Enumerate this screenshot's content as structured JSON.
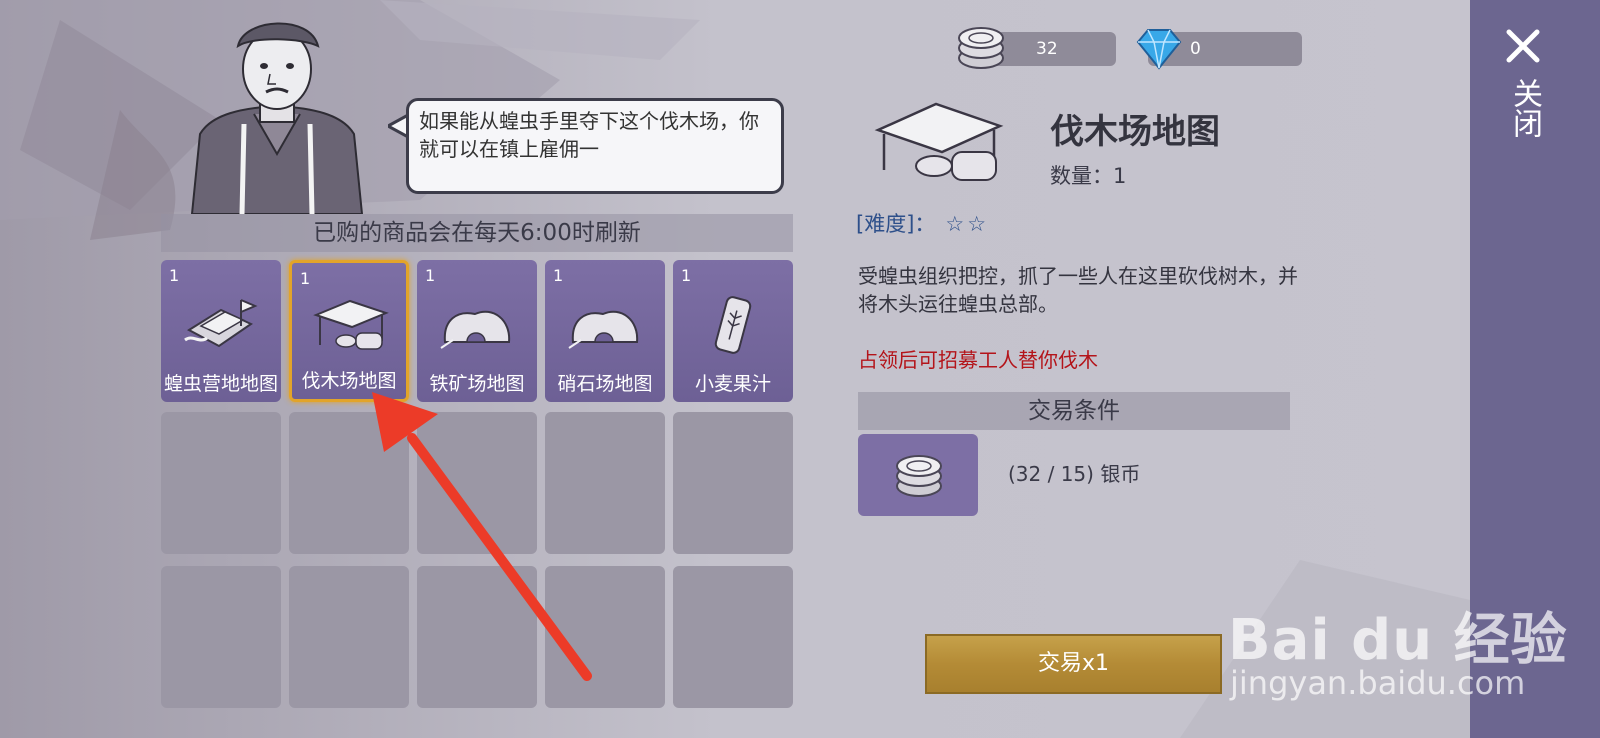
{
  "currency": {
    "silver_value": "32",
    "gem_value": "0"
  },
  "close": {
    "label": "关闭"
  },
  "npc": {
    "dialog": "如果能从蝗虫手里夺下这个伐木场，你就可以在镇上雇佣一"
  },
  "shop": {
    "refresh_notice": "已购的商品会在每天6:00时刷新",
    "items": [
      {
        "count": "1",
        "name": "蝗虫营地地图",
        "icon": "camp-map-icon"
      },
      {
        "count": "1",
        "name": "伐木场地图",
        "icon": "lumberyard-map-icon",
        "selected": true
      },
      {
        "count": "1",
        "name": "铁矿场地图",
        "icon": "iron-mine-map-icon"
      },
      {
        "count": "1",
        "name": "硝石场地图",
        "icon": "saltpeter-mine-map-icon"
      },
      {
        "count": "1",
        "name": "小麦果汁",
        "icon": "wheat-juice-can-icon"
      }
    ]
  },
  "detail": {
    "title": "伐木场地图",
    "quantity_label": "数量：1",
    "difficulty_label": "[难度]：",
    "difficulty_stars": "☆☆",
    "description": "受蝗虫组织把控，抓了一些人在这里砍伐树木，并将木头运往蝗虫总部。",
    "effect": "占领后可招募工人替你伐木",
    "trade_header": "交易条件",
    "cost_text": "(32 / 15) 银币",
    "trade_button": "交易x1"
  },
  "watermark": {
    "line1": "Bai du 经验",
    "line2": "jingyan.baidu.com"
  },
  "colors": {
    "panel_bg": "#c4c2cc",
    "slot_item": "#7d6fa5",
    "slot_empty": "#9b97a5",
    "selected_border": "#e2a42a",
    "effect_red": "#b4141a",
    "difficulty_blue": "#2d4f8a",
    "trade_gold": "#b48b36",
    "arrow_red": "#ec3b28",
    "close_bar": "#6c6690"
  }
}
